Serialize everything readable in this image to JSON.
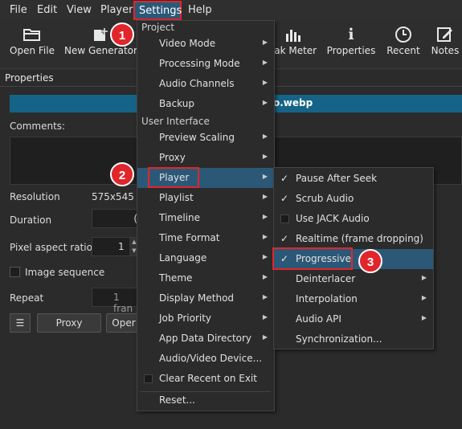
{
  "menubar": {
    "items": [
      "File",
      "Edit",
      "View",
      "Player",
      "Settings",
      "Help"
    ]
  },
  "toolbar": {
    "buttons": [
      {
        "label": "Open File",
        "icon": "folder-open-icon"
      },
      {
        "label": "New Generator",
        "icon": "new-generator-icon"
      },
      {
        "label": "eak Meter",
        "icon": "peak-meter-icon"
      },
      {
        "label": "Properties",
        "icon": "info-icon"
      },
      {
        "label": "Recent",
        "icon": "clock-icon"
      },
      {
        "label": "Notes",
        "icon": "notes-icon"
      }
    ]
  },
  "properties": {
    "title": "Properties",
    "filename": "o.webp",
    "comments_label": "Comments:",
    "resolution_label": "Resolution",
    "resolution_value": "575x545",
    "duration_label": "Duration",
    "duration_value": "(",
    "pixel_aspect_label": "Pixel aspect ratio",
    "pixel_aspect_value": "1",
    "image_sequence_label": "Image sequence",
    "repeat_label": "Repeat",
    "repeat_value": "1 fran",
    "menu_button": "☰",
    "proxy_button": "Proxy",
    "open_button": "Oper"
  },
  "settings_menu": {
    "section_project": "Project",
    "project_items": [
      {
        "label": "Video Mode"
      },
      {
        "label": "Processing Mode"
      },
      {
        "label": "Audio Channels"
      },
      {
        "label": "Backup"
      }
    ],
    "section_ui": "User Interface",
    "ui_items": [
      {
        "label": "Preview Scaling"
      },
      {
        "label": "Proxy"
      },
      {
        "label": "Player"
      },
      {
        "label": "Playlist"
      },
      {
        "label": "Timeline"
      },
      {
        "label": "Time Format"
      },
      {
        "label": "Language"
      },
      {
        "label": "Theme"
      },
      {
        "label": "Display Method"
      },
      {
        "label": "Job Priority"
      },
      {
        "label": "App Data Directory"
      },
      {
        "label": "Audio/Video Device..."
      },
      {
        "label": "Clear Recent on Exit"
      },
      {
        "label": "Reset..."
      }
    ]
  },
  "player_submenu": {
    "items": [
      {
        "label": "Pause After Seek",
        "checked": true
      },
      {
        "label": "Scrub Audio",
        "checked": true
      },
      {
        "label": "Use JACK Audio",
        "checked": false
      },
      {
        "label": "Realtime (frame dropping)",
        "checked": true
      },
      {
        "label": "Progressive",
        "checked": true
      },
      {
        "label": "Deinterlacer"
      },
      {
        "label": "Interpolation"
      },
      {
        "label": "Audio API"
      },
      {
        "label": "Synchronization..."
      }
    ]
  },
  "badges": [
    "1",
    "2",
    "3"
  ],
  "glyphs": {
    "check": "✓",
    "arrow": "▶"
  },
  "colors": {
    "highlight": "#2c5877",
    "annotation": "#e0262b",
    "filename_bar": "#156487"
  }
}
